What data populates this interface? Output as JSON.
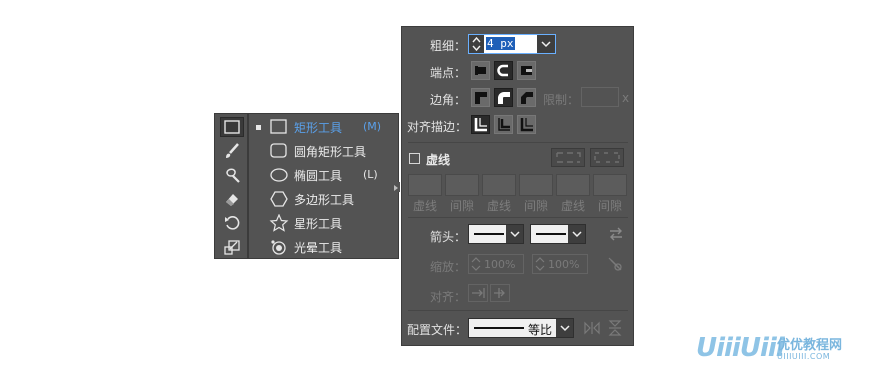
{
  "tools_panel": {
    "tools": [
      {
        "icon": "rectangle-tool-icon",
        "active": true
      },
      {
        "icon": "paintbrush-icon"
      },
      {
        "icon": "blob-brush-icon"
      },
      {
        "icon": "eraser-icon"
      },
      {
        "icon": "rotate-icon"
      },
      {
        "icon": "scale-icon"
      }
    ]
  },
  "shape_flyout": {
    "items": [
      {
        "label": "矩形工具",
        "shortcut": "(M)",
        "icon": "rectangle-icon",
        "selected": true
      },
      {
        "label": "圆角矩形工具",
        "shortcut": "",
        "icon": "rounded-rectangle-icon"
      },
      {
        "label": "椭圆工具",
        "shortcut": "(L)",
        "icon": "ellipse-icon"
      },
      {
        "label": "多边形工具",
        "shortcut": "",
        "icon": "polygon-icon"
      },
      {
        "label": "星形工具",
        "shortcut": "",
        "icon": "star-icon"
      },
      {
        "label": "光晕工具",
        "shortcut": "",
        "icon": "flare-icon"
      }
    ],
    "accent_color": "#5aa0ea"
  },
  "stroke_panel": {
    "weight_label": "粗细：",
    "weight_value": "4 px",
    "cap_label": "端点：",
    "corner_label": "边角：",
    "limit_label": "限制：",
    "limit_suffix": "x",
    "align_label": "对齐描边：",
    "dashed_label": "虚线",
    "dash_labels": [
      "虚线",
      "间隙",
      "虚线",
      "间隙",
      "虚线",
      "间隙"
    ],
    "arrow_label": "箭头：",
    "scale_label": "缩放：",
    "scale_start": "100%",
    "scale_end": "100%",
    "align_arrow_label": "对齐：",
    "profile_label": "配置文件：",
    "profile_value": "等比"
  },
  "watermark": {
    "logo": "UiiiUiii",
    "cn": "优优教程网",
    "url": "UIIIUIII.COM"
  }
}
